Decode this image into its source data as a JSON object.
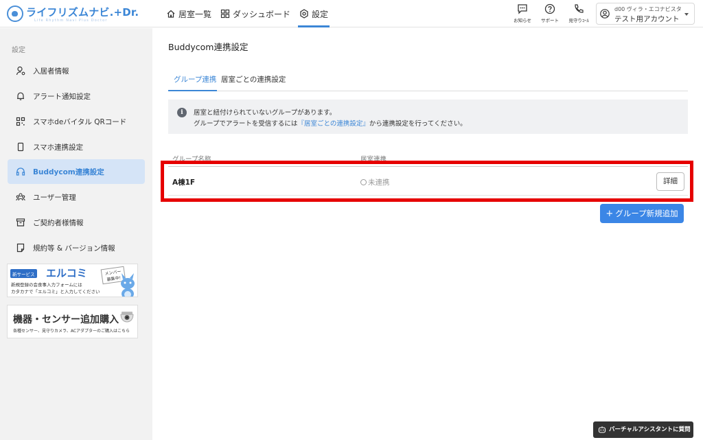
{
  "header": {
    "logo_text": "ライフリズムナビ.+Dr.",
    "logo_sub": "Life Rhythm Navi  Plus Doctor",
    "nav": [
      {
        "label": "居室一覧",
        "icon": "home-icon"
      },
      {
        "label": "ダッシュボード",
        "icon": "grid-icon"
      },
      {
        "label": "設定",
        "icon": "gear-icon",
        "active": true
      }
    ],
    "buttons": [
      {
        "label": "お知らせ",
        "icon": "message-icon"
      },
      {
        "label": "サポート",
        "icon": "help-icon"
      },
      {
        "label": "見守りｺｰﾙ",
        "icon": "phone-icon"
      }
    ],
    "account": {
      "id_line": "d00 ヴィラ・エコナビスタ",
      "name": "テスト用アカウント"
    }
  },
  "sidebar": {
    "title": "設定",
    "items": [
      {
        "label": "入居者情報",
        "icon": "resident-icon"
      },
      {
        "label": "アラート通知設定",
        "icon": "bell-icon"
      },
      {
        "label": "スマホdeバイタル QRコード",
        "icon": "qr-icon"
      },
      {
        "label": "スマホ連携設定",
        "icon": "smartphone-icon"
      },
      {
        "label": "Buddycom連携設定",
        "icon": "headset-icon",
        "active": true
      },
      {
        "label": "ユーザー管理",
        "icon": "users-icon"
      },
      {
        "label": "ご契約者様情報",
        "icon": "archive-icon"
      },
      {
        "label": "規約等 & バージョン情報",
        "icon": "document-icon"
      }
    ],
    "banner1": {
      "tag": "新サービス",
      "title": "エルコミ",
      "line1": "新規登録の会食事入力フォームには",
      "line2": "カタカナで「エルコミ」と入力してください",
      "sign": "メンバー\n募集中!"
    },
    "banner2": {
      "title": "機器・センサー追加購入",
      "line1": "各種センサー、見守りカメラ、ACアダプターのご購入はこちら"
    }
  },
  "main": {
    "title": "Buddycom連携設定",
    "tabs": [
      {
        "label": "グループ連携",
        "active": true
      },
      {
        "label": "居室ごとの連携設定",
        "active": false
      }
    ],
    "notice": {
      "line1": "居室と紐付けられていないグループがあります。",
      "line2_pre": "グループでアラートを受信するには",
      "line2_link": "『居室ごとの連携設定』",
      "line2_post": "から連携設定を行ってください。"
    },
    "table": {
      "columns": [
        "グループ名称",
        "居室連携"
      ],
      "rows": [
        {
          "name": "A棟1F",
          "status": "未連携",
          "action": "詳細"
        }
      ]
    },
    "add_button": "グループ新規追加"
  },
  "assistant": {
    "label": "バーチャルアシスタントに質問"
  },
  "colors": {
    "accent": "#3b86d6",
    "highlight": "#e60000",
    "sidebar_bg": "#f2f2f2",
    "active_bg": "#d5e4f7"
  }
}
